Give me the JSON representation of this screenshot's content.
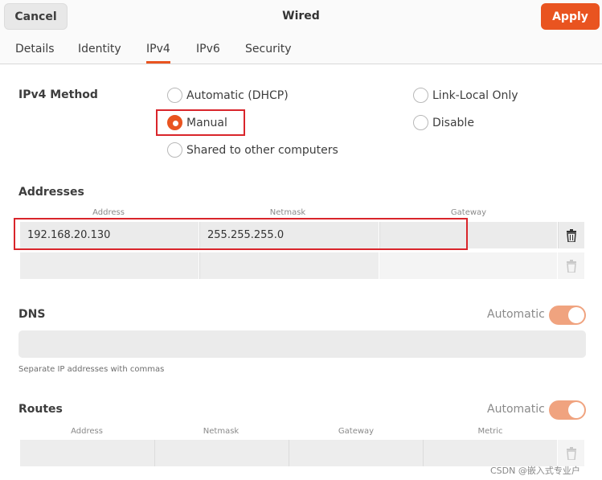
{
  "header": {
    "cancel_label": "Cancel",
    "title": "Wired",
    "apply_label": "Apply",
    "accent": "#e95420"
  },
  "tabs": [
    {
      "label": "Details"
    },
    {
      "label": "Identity"
    },
    {
      "label": "IPv4"
    },
    {
      "label": "IPv6"
    },
    {
      "label": "Security"
    }
  ],
  "active_tab": "IPv4",
  "method": {
    "title": "IPv4 Method",
    "options": [
      {
        "label": "Automatic (DHCP)",
        "checked": false
      },
      {
        "label": "Link-Local Only",
        "checked": false
      },
      {
        "label": "Manual",
        "checked": true
      },
      {
        "label": "Disable",
        "checked": false
      },
      {
        "label": "Shared to other computers",
        "checked": false
      }
    ]
  },
  "addresses": {
    "title": "Addresses",
    "columns": [
      "Address",
      "Netmask",
      "Gateway"
    ],
    "rows": [
      {
        "address": "192.168.20.130",
        "netmask": "255.255.255.0",
        "gateway": ""
      },
      {
        "address": "",
        "netmask": "",
        "gateway": ""
      }
    ]
  },
  "dns": {
    "title": "DNS",
    "auto_label": "Automatic",
    "auto_enabled": true,
    "value": "",
    "hint": "Separate IP addresses with commas"
  },
  "routes": {
    "title": "Routes",
    "auto_label": "Automatic",
    "auto_enabled": true,
    "columns": [
      "Address",
      "Netmask",
      "Gateway",
      "Metric"
    ]
  },
  "watermark": "CSDN @嵌入式专业户"
}
